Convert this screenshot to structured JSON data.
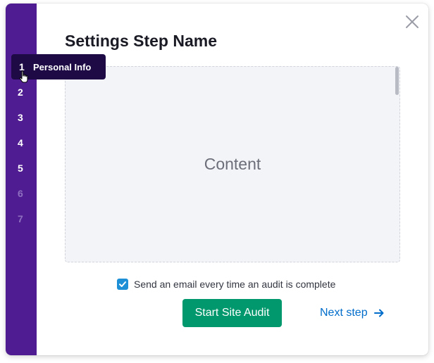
{
  "dialog": {
    "title": "Settings Step Name",
    "content_placeholder": "Content"
  },
  "stepper": {
    "steps": [
      {
        "number": "1",
        "enabled": true
      },
      {
        "number": "2",
        "enabled": true
      },
      {
        "number": "3",
        "enabled": true
      },
      {
        "number": "4",
        "enabled": true
      },
      {
        "number": "5",
        "enabled": true
      },
      {
        "number": "6",
        "enabled": false
      },
      {
        "number": "7",
        "enabled": false
      }
    ],
    "tooltip": {
      "number": "1",
      "label": "Personal Info"
    }
  },
  "options": {
    "email_checkbox": {
      "label": "Send an email every time an audit is complete",
      "checked": true
    }
  },
  "actions": {
    "primary_label": "Start Site Audit",
    "next_label": "Next step"
  },
  "colors": {
    "stepper_bg": "#4f1d91",
    "tooltip_bg": "#1e0b46",
    "primary_button": "#00986c",
    "link": "#006dca",
    "checkbox": "#1c8fd6"
  },
  "icons": [
    "close-icon",
    "check-icon",
    "arrow-right-icon",
    "pointer-cursor-icon"
  ]
}
